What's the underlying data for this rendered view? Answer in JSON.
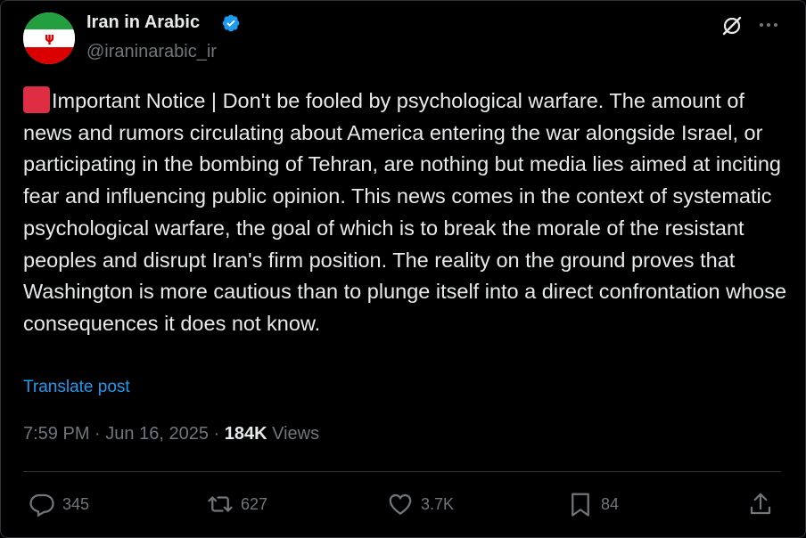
{
  "author": {
    "name": "Iran in Arabic",
    "handle": "@iraninarabic_ir"
  },
  "post": {
    "text": "Important Notice | Don't be fooled by psychological warfare. The amount of news and rumors circulating about America entering the war alongside Israel, or participating in the bombing of Tehran, are nothing but media lies aimed at inciting fear and influencing public opinion. This news comes in the context of systematic psychological warfare, the goal of which is to break the morale of the resistant peoples and disrupt Iran's firm position. The reality on the ground proves that Washington is more cautious than to plunge itself into a direct confrontation whose consequences it does not know.",
    "translate_label": "Translate post"
  },
  "meta": {
    "time": "7:59 PM",
    "date": "Jun 16, 2025",
    "sep": "·",
    "views_count": "184K",
    "views_label": "Views"
  },
  "actions": {
    "replies": "345",
    "reposts": "627",
    "likes": "3.7K",
    "bookmarks": "84"
  },
  "icons": {
    "verified": "verified-badge-icon",
    "grok": "grok-icon",
    "more": "more-icon",
    "reply": "reply-icon",
    "repost": "repost-icon",
    "like": "heart-icon",
    "bookmark": "bookmark-icon",
    "share": "share-icon"
  },
  "colors": {
    "background": "#000000",
    "text": "#e7e9ea",
    "muted": "#71767b",
    "link": "#1d9bf0",
    "verified": "#1d9bf0",
    "notice_square": "#dd2e44"
  }
}
